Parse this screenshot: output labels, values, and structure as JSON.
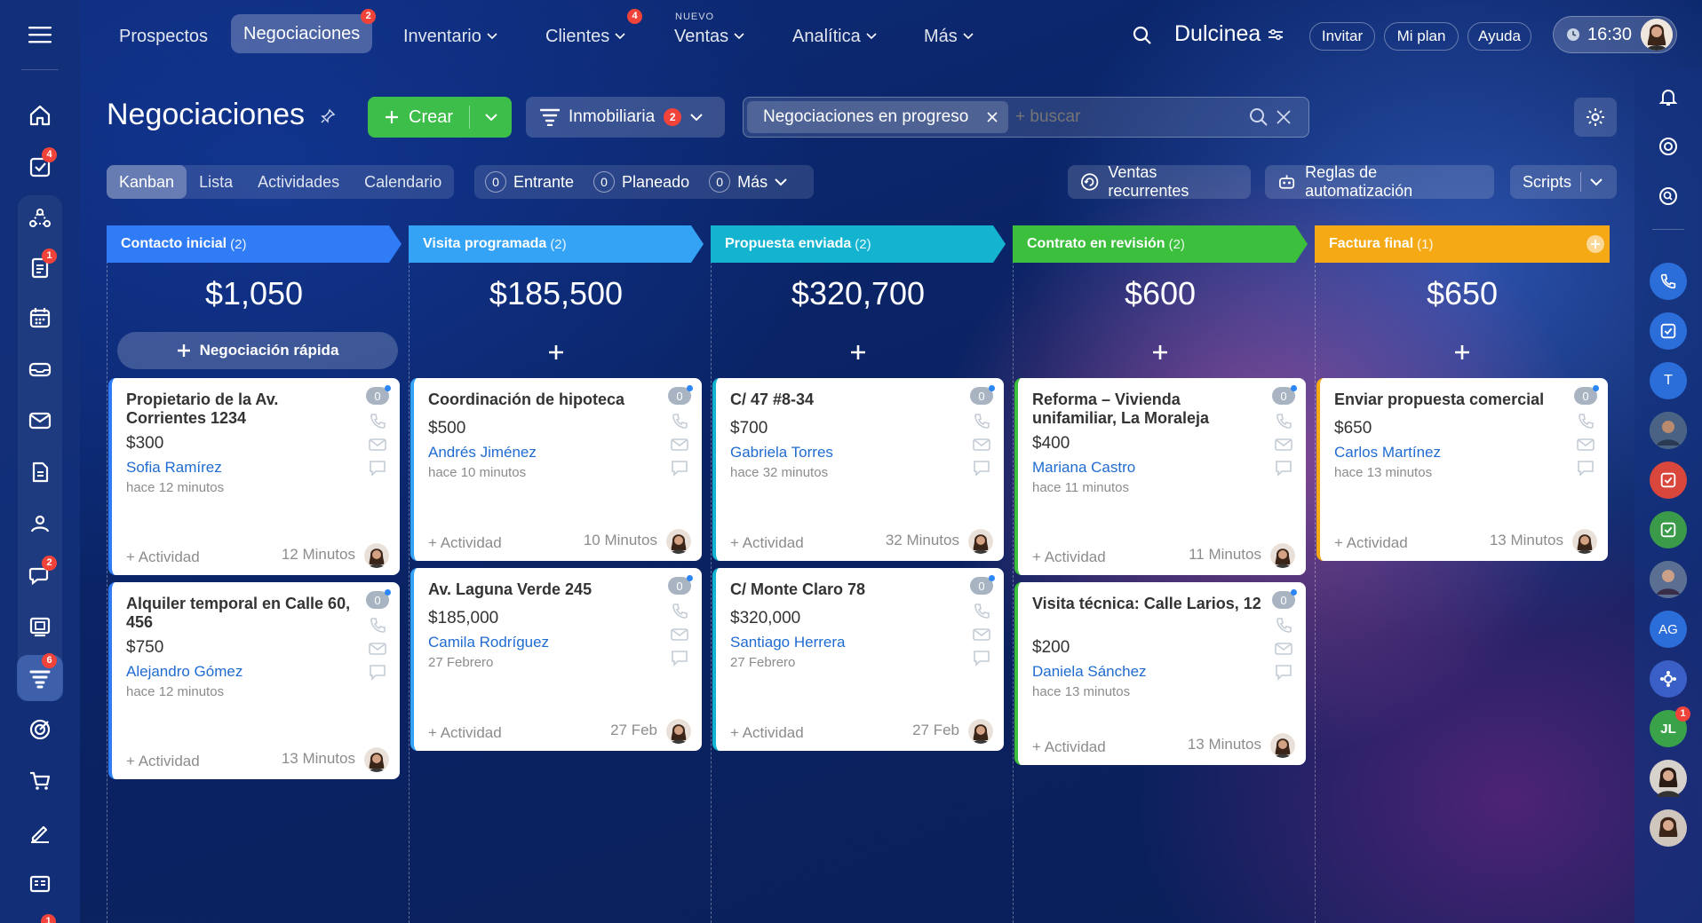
{
  "nav": {
    "items": [
      "Prospectos",
      "Negociaciones",
      "Inventario",
      "Clientes",
      "Ventas",
      "Analítica",
      "Más"
    ],
    "badges": {
      "negociaciones": "2",
      "clientes": "4"
    },
    "nuevo_label": "NUEVO",
    "user_name": "Dulcinea",
    "invite": "Invitar",
    "plan": "Mi plan",
    "help": "Ayuda",
    "time": "16:30"
  },
  "sidebar": {
    "badges": {
      "tasks": "4",
      "docs": "1",
      "chat": "2",
      "crm": "6",
      "bottom": "1"
    }
  },
  "header": {
    "title": "Negociaciones",
    "create": "Crear",
    "pipeline": "Inmobiliaria",
    "pipeline_badge": "2",
    "filter_chip": "Negociaciones en progreso",
    "search_placeholder": "+ buscar"
  },
  "views": {
    "tabs": [
      "Kanban",
      "Lista",
      "Actividades",
      "Calendario"
    ],
    "counters": [
      {
        "n": "0",
        "label": "Entrante"
      },
      {
        "n": "0",
        "label": "Planeado"
      },
      {
        "n": "0",
        "label": "Más"
      }
    ],
    "recurring": "Ventas recurrentes",
    "rules": "Reglas de automatización",
    "scripts": "Scripts"
  },
  "colors": {
    "stage1": "#2f7cf6",
    "stage2": "#35a3f5",
    "stage3": "#14b4d1",
    "stage4": "#3cbf3c",
    "stage5": "#f5a915",
    "create": "#3dbd4a",
    "link": "#1f6bd1"
  },
  "stages": [
    {
      "name": "Contacto inicial",
      "count": "(2)",
      "sum": "$1,050",
      "quick": "Negociación rápida",
      "cards": [
        {
          "title": "Propietario de la Av. Corrientes 1234",
          "amount": "$300",
          "contact": "Sofia Ramírez",
          "time": "hace 12 minutos",
          "activity": "+ Actividad",
          "deadline": "12 Minutos",
          "badge": "0"
        },
        {
          "title": "Alquiler temporal en Calle 60, 456",
          "amount": "$750",
          "contact": "Alejandro Gómez",
          "time": "hace 12 minutos",
          "activity": "+ Actividad",
          "deadline": "13 Minutos",
          "badge": "0"
        }
      ]
    },
    {
      "name": "Visita programada",
      "count": "(2)",
      "sum": "$185,500",
      "cards": [
        {
          "title": "Coordinación de hipoteca",
          "amount": "$500",
          "contact": "Andrés Jiménez",
          "time": "hace 10 minutos",
          "activity": "+ Actividad",
          "deadline": "10 Minutos",
          "badge": "0"
        },
        {
          "title": "Av. Laguna Verde 245",
          "amount": "$185,000",
          "contact": "Camila Rodríguez",
          "time": "27 Febrero",
          "activity": "+ Actividad",
          "deadline": "27 Feb",
          "badge": "0"
        }
      ]
    },
    {
      "name": "Propuesta enviada",
      "count": "(2)",
      "sum": "$320,700",
      "cards": [
        {
          "title": "C/ 47 #8-34",
          "amount": "$700",
          "contact": "Gabriela Torres",
          "time": "hace 32 minutos",
          "activity": "+ Actividad",
          "deadline": "32 Minutos",
          "badge": "0"
        },
        {
          "title": "C/ Monte Claro 78",
          "amount": "$320,000",
          "contact": "Santiago Herrera",
          "time": "27 Febrero",
          "activity": "+ Actividad",
          "deadline": "27 Feb",
          "badge": "0"
        }
      ]
    },
    {
      "name": "Contrato en revisión",
      "count": "(2)",
      "sum": "$600",
      "cards": [
        {
          "title": "Reforma – Vivienda unifamiliar, La Moraleja",
          "amount": "$400",
          "contact": "Mariana Castro",
          "time": "hace 11 minutos",
          "activity": "+ Actividad",
          "deadline": "11 Minutos",
          "badge": "0"
        },
        {
          "title": "Visita técnica: Calle Larios, 12",
          "amount": "$200",
          "contact": "Daniela Sánchez",
          "time": "hace 13 minutos",
          "activity": "+ Actividad",
          "deadline": "13 Minutos",
          "badge": "0"
        }
      ]
    },
    {
      "name": "Factura final",
      "count": "(1)",
      "sum": "$650",
      "cards": [
        {
          "title": "Enviar propuesta comercial",
          "amount": "$650",
          "contact": "Carlos Martínez",
          "time": "hace 13 minutos",
          "activity": "+ Actividad",
          "deadline": "13 Minutos",
          "badge": "0"
        }
      ]
    }
  ],
  "right_sidebar": {
    "initials_t": "T",
    "initials_ag": "AG",
    "initials_jl": "JL",
    "jl_badge": "1"
  }
}
